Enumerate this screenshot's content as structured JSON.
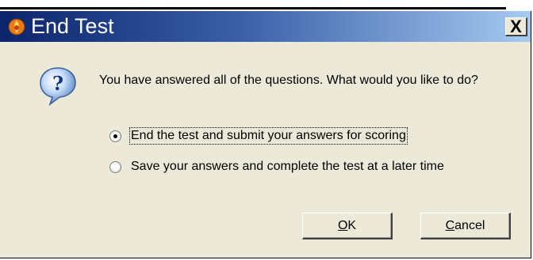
{
  "dialog": {
    "title": "End Test",
    "close_label": "X",
    "message": "You have answered all of the questions. What would you like to do?",
    "options": [
      {
        "label": "End the test and submit your answers for scoring",
        "selected": true
      },
      {
        "label": "Save your answers and complete the test at a later time",
        "selected": false
      }
    ],
    "ok_label_mnemonic": "O",
    "ok_label_rest": "K",
    "cancel_label_mnemonic": "C",
    "cancel_label_rest": "ancel"
  },
  "icons": {
    "title": "app-icon",
    "message": "question-icon"
  },
  "colors": {
    "titlebar_start": "#0b246a",
    "titlebar_end": "#a6caf0",
    "dialog_bg": "#ece9d8"
  }
}
